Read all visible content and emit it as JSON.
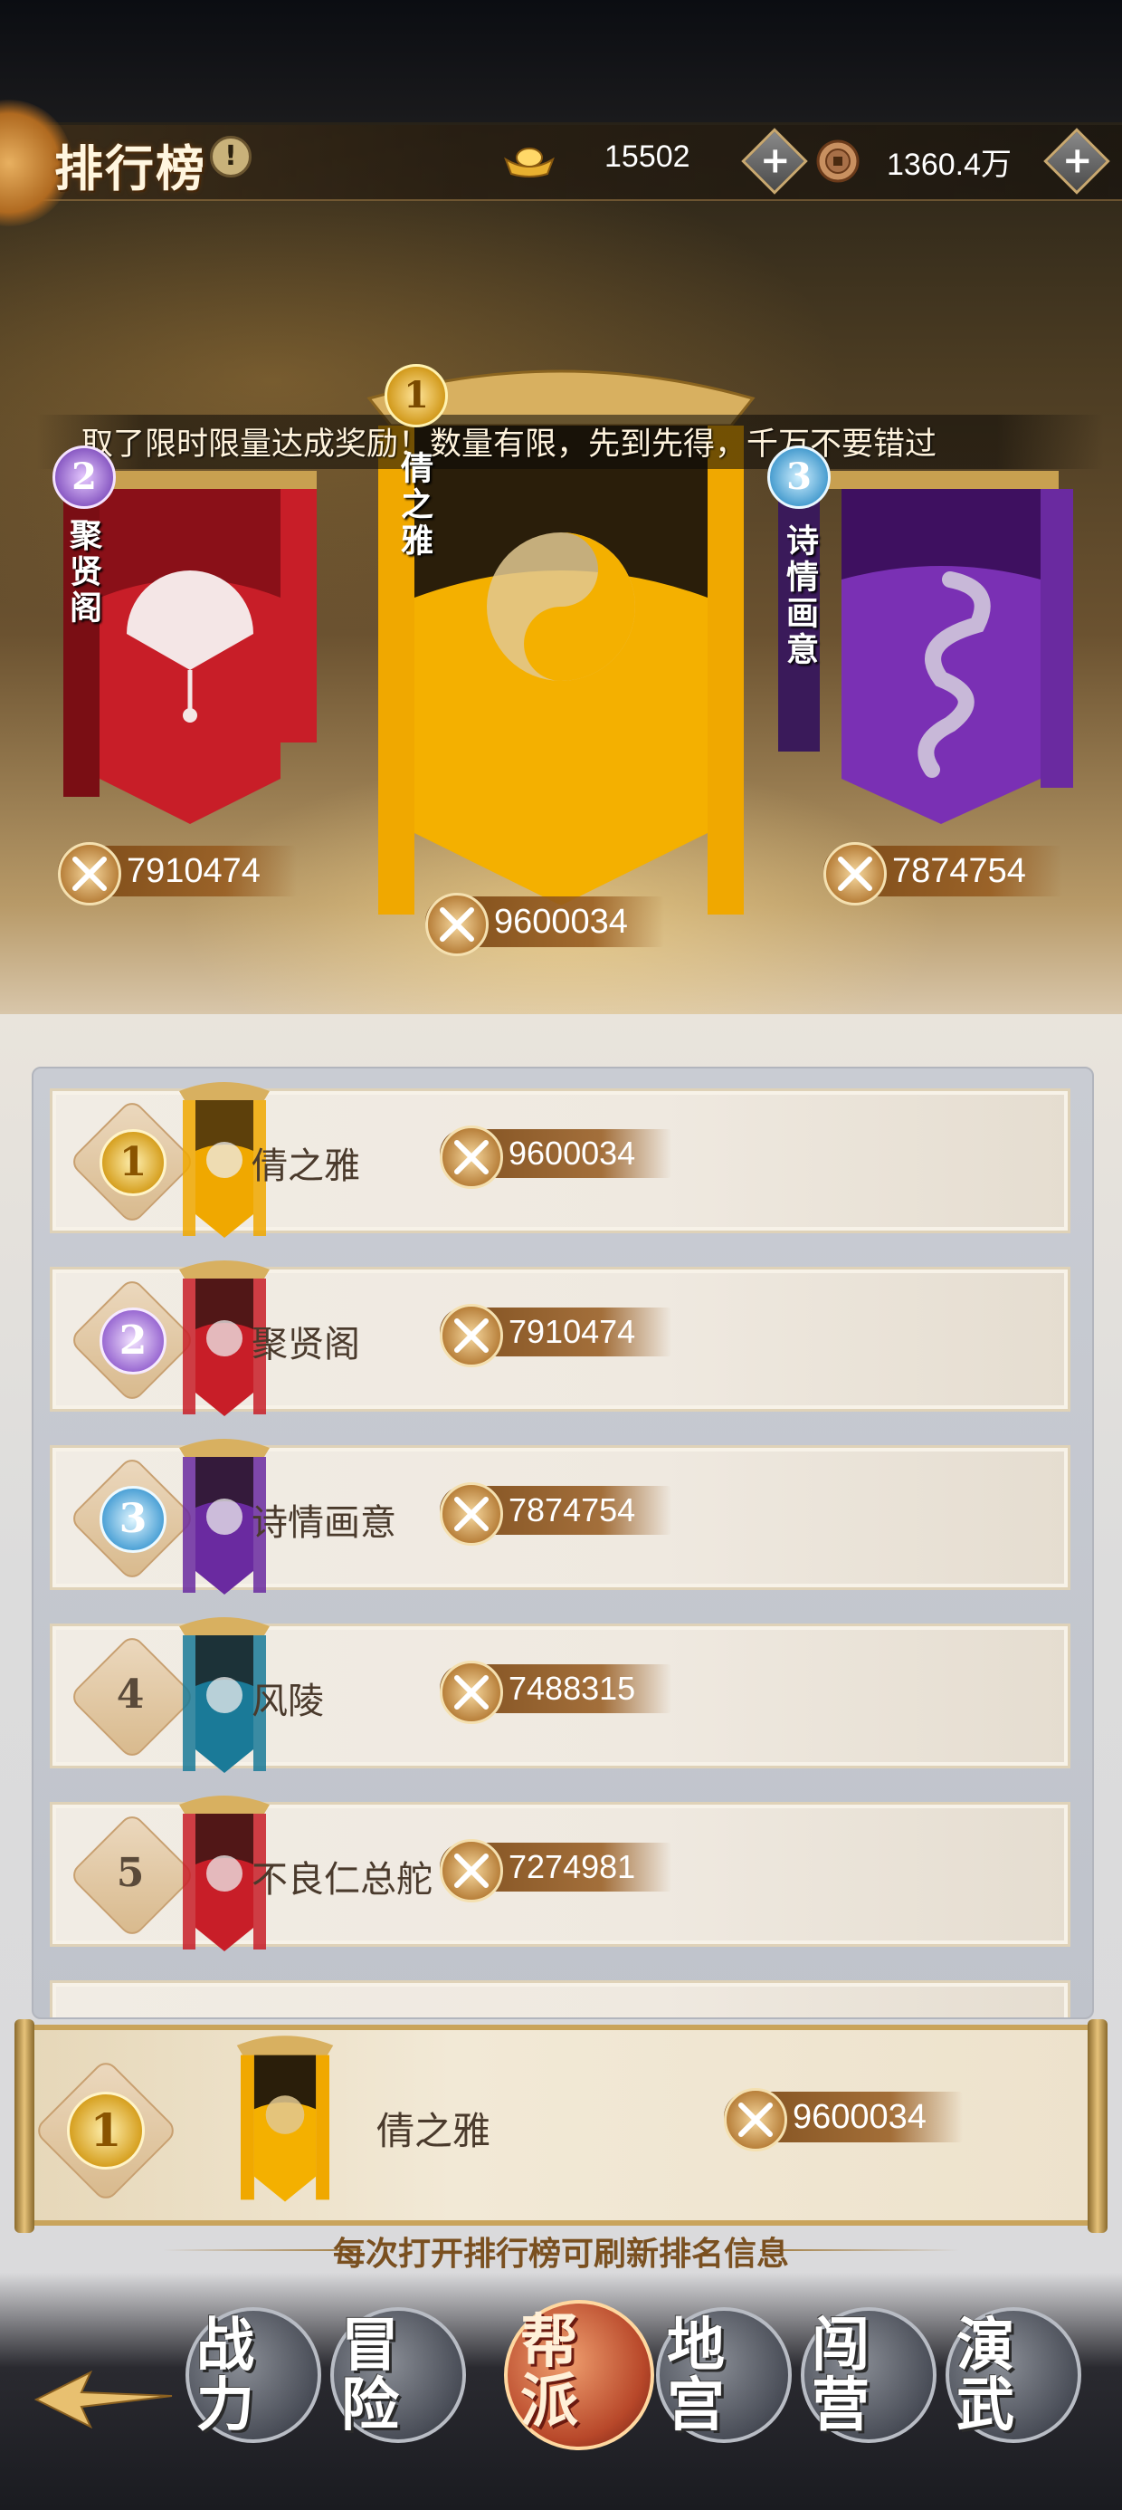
{
  "header": {
    "title": "排行榜",
    "gold": "15502",
    "coins": "1360.4万"
  },
  "marquee": "取了限时限量达成奖励！数量有限，先到先得，千万不要错过",
  "podium": [
    {
      "rank": "2",
      "name": "聚贤阁",
      "power": "7910474",
      "color": "#c81e28",
      "emblem": "fan-emblem"
    },
    {
      "rank": "1",
      "name": "倩之雅",
      "power": "9600034",
      "color": "#f0a800",
      "emblem": "taiji-emblem"
    },
    {
      "rank": "3",
      "name": "诗情画意",
      "power": "7874754",
      "color": "#6a2aa0",
      "emblem": "dragon-emblem"
    }
  ],
  "rankings": [
    {
      "rank": "1",
      "name": "倩之雅",
      "power": "9600034",
      "color": "#f0a800",
      "emblem": "taiji-emblem"
    },
    {
      "rank": "2",
      "name": "聚贤阁",
      "power": "7910474",
      "color": "#c81e28",
      "emblem": "fan-emblem"
    },
    {
      "rank": "3",
      "name": "诗情画意",
      "power": "7874754",
      "color": "#6a2aa0",
      "emblem": "dragon-emblem"
    },
    {
      "rank": "4",
      "name": "风陵",
      "power": "7488315",
      "color": "#1a7a98",
      "emblem": "mask-emblem"
    },
    {
      "rank": "5",
      "name": "不良仁总舵",
      "power": "7274981",
      "color": "#c81e28",
      "emblem": "fan-emblem"
    }
  ],
  "self": {
    "rank": "1",
    "name": "倩之雅",
    "power": "9600034"
  },
  "hint": "每次打开排行榜可刷新排名信息",
  "nav_tabs": [
    "战力",
    "冒险",
    "帮派",
    "地宫",
    "闯营",
    "演武"
  ],
  "active_tab": "帮派"
}
